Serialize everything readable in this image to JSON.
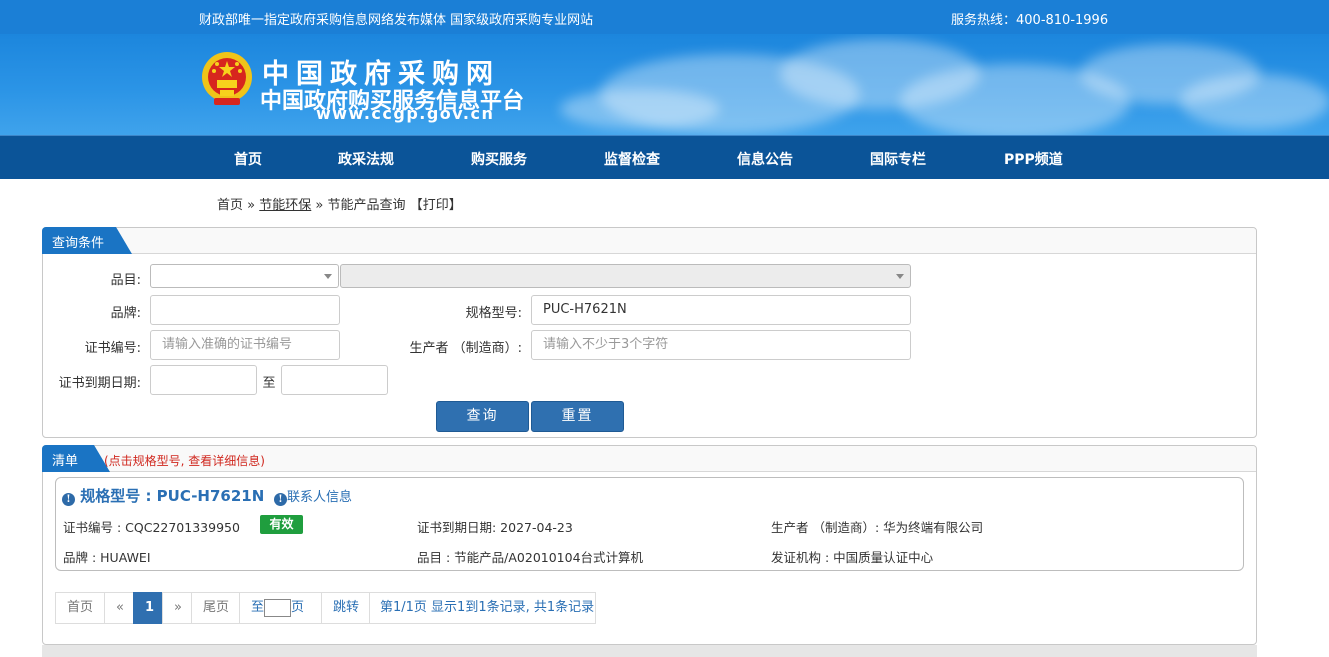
{
  "topbar": {
    "slogan": "财政部唯一指定政府采购信息网络发布媒体 国家级政府采购专业网站",
    "hotline": "服务热线：400-810-1996"
  },
  "banner": {
    "title": "中国政府采购网",
    "subtitle": "中国政府购买服务信息平台",
    "url": "www.ccgp.gov.cn",
    "emblem_icon": "national-emblem-icon"
  },
  "nav": {
    "items": [
      "首页",
      "政采法规",
      "购买服务",
      "监督检查",
      "信息公告",
      "国际专栏",
      "PPP频道"
    ]
  },
  "breadcrumb": {
    "home": "首页",
    "sep1": "»",
    "section": "节能环保",
    "sep2": "»",
    "current": "节能产品查询",
    "print": "【打印】"
  },
  "query": {
    "tab": "查询条件",
    "category_label": "品目:",
    "brand_label": "品牌:",
    "brand_value": "",
    "model_label": "规格型号:",
    "model_value": "PUC-H7621N",
    "cert_label": "证书编号:",
    "cert_placeholder": "请输入准确的证书编号",
    "maker_label": "生产者 （制造商）:",
    "maker_placeholder": "请输入不少于3个字符",
    "expiry_label": "证书到期日期:",
    "to": "至",
    "search_button": "查询",
    "reset_button": "重置"
  },
  "results": {
    "tab": "清单",
    "hint": "(点击规格型号, 查看详细信息)",
    "item": {
      "model": "规格型号 : PUC-H7621N",
      "contact": "联系人信息",
      "cert": "证书编号 : CQC22701339950",
      "status": "有效",
      "expiry": "证书到期日期: 2027-04-23",
      "maker": "生产者 （制造商）: 华为终端有限公司",
      "brand": "品牌 : HUAWEI",
      "category": "品目 : 节能产品/A02010104台式计算机",
      "issuer": "发证机构 : 中国质量认证中心"
    },
    "status_color": "#1f9e3e"
  },
  "pager": {
    "first": "首页",
    "prev": "«",
    "current": "1",
    "next": "»",
    "last": "尾页",
    "goto_prefix": "至",
    "goto_suffix": "页",
    "jump": "跳转",
    "summary": "第1/1页  显示1到1条记录, 共1条记录"
  },
  "colors": {
    "topbar": "#1b7fd6",
    "nav": "#0b5498",
    "accent": "#1a74c4",
    "link": "#2a6fb4"
  }
}
